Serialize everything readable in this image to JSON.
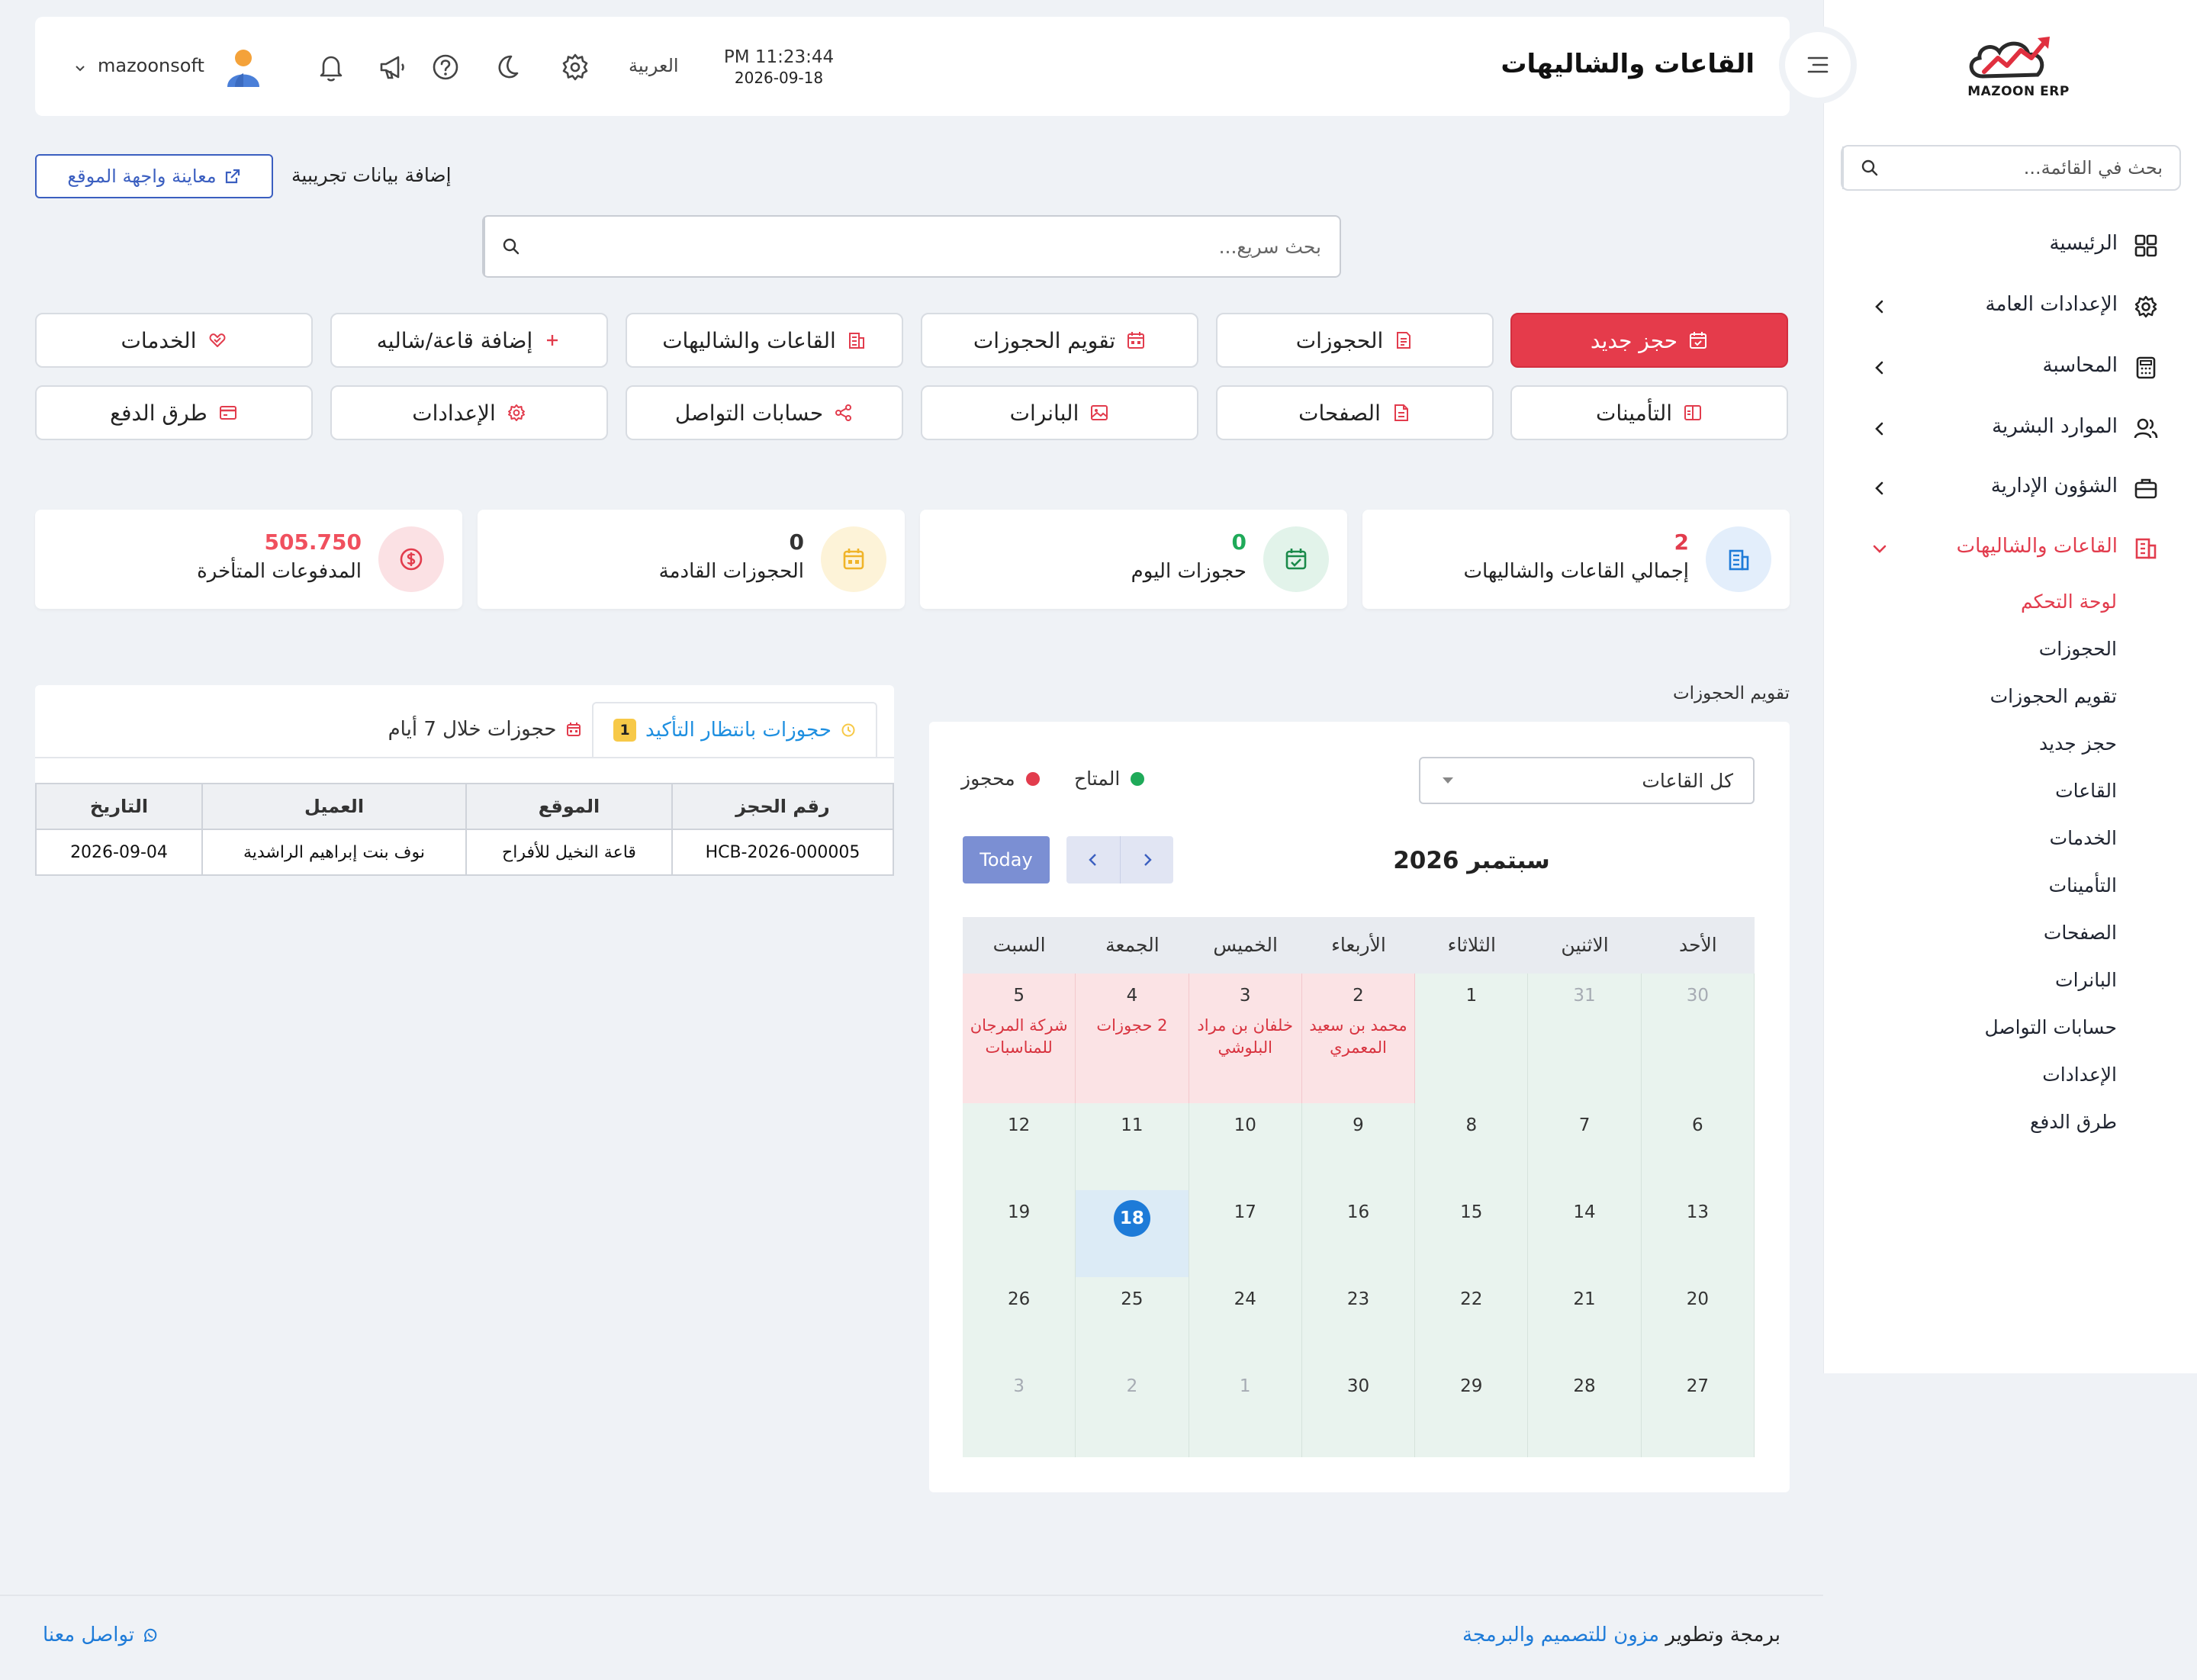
{
  "brand": {
    "logo_text": "MAZOON ERP"
  },
  "sidebar": {
    "search_placeholder": "بحث في القائمة...",
    "items": [
      {
        "label": "الرئيسية",
        "icon": "grid-icon"
      },
      {
        "label": "الإعدادات العامة",
        "icon": "gear-icon"
      },
      {
        "label": "المحاسبة",
        "icon": "calculator-icon"
      },
      {
        "label": "الموارد البشرية",
        "icon": "users-icon"
      },
      {
        "label": "الشؤون الإدارية",
        "icon": "briefcase-icon"
      },
      {
        "label": "القاعات والشاليهات",
        "icon": "building-icon"
      }
    ],
    "sub_items": [
      "لوحة التحكم",
      "الحجوزات",
      "تقويم الحجوزات",
      "حجز جديد",
      "القاعات",
      "الخدمات",
      "التأمينات",
      "الصفحات",
      "البانرات",
      "حسابات التواصل",
      "الإعدادات",
      "طرق الدفع"
    ]
  },
  "header": {
    "title": "القاعات والشاليهات",
    "time": "PM 11:23:44",
    "date": "2026-09-18",
    "language": "العربية",
    "username": "mazoonsoft"
  },
  "toolbar": {
    "preview_label": "معاينة واجهة الموقع",
    "demo_data_label": "إضافة بيانات تجريبية",
    "quick_search_placeholder": "بحث سريع..."
  },
  "actions": [
    {
      "label": "حجز جديد",
      "icon": "calendar-check-icon"
    },
    {
      "label": "الحجوزات",
      "icon": "list-doc-icon"
    },
    {
      "label": "تقويم الحجوزات",
      "icon": "calendar-icon"
    },
    {
      "label": "القاعات والشاليهات",
      "icon": "building-icon"
    },
    {
      "label": "إضافة قاعة/شاليه",
      "icon": "plus-icon"
    },
    {
      "label": "الخدمات",
      "icon": "heart-hand-icon"
    },
    {
      "label": "التأمينات",
      "icon": "shield-icon"
    },
    {
      "label": "الصفحات",
      "icon": "page-icon"
    },
    {
      "label": "البانرات",
      "icon": "image-icon"
    },
    {
      "label": "حسابات التواصل",
      "icon": "share-icon"
    },
    {
      "label": "الإعدادات",
      "icon": "gear-icon"
    },
    {
      "label": "طرق الدفع",
      "icon": "credit-card-icon"
    }
  ],
  "stats": [
    {
      "value": "2",
      "label": "إجمالي القاعات والشاليهات",
      "color": "#e23c4d",
      "icon": "building-icon"
    },
    {
      "value": "0",
      "label": "حجوزات اليوم",
      "color": "#1faa59",
      "icon": "calendar-check-icon"
    },
    {
      "value": "0",
      "label": "الحجوزات القادمة",
      "color": "#333333",
      "icon": "calendar-icon"
    },
    {
      "value": "505.750",
      "label": "المدفوعات المتأخرة",
      "color": "#f0505e",
      "icon": "dollar-icon"
    }
  ],
  "calendar": {
    "section_title": "تقويم الحجوزات",
    "hall_filter": "كل القاعات",
    "legend_available": "المتاح",
    "legend_booked": "محجوز",
    "today_label": "Today",
    "month_title": "سبتمبر 2026",
    "weekdays": [
      "الأحد",
      "الاثنين",
      "الثلاثاء",
      "الأربعاء",
      "الخميس",
      "الجمعة",
      "السبت"
    ],
    "weeks": [
      [
        {
          "d": "30",
          "muted": true,
          "state": "free"
        },
        {
          "d": "31",
          "muted": true,
          "state": "free"
        },
        {
          "d": "1",
          "state": "free"
        },
        {
          "d": "2",
          "state": "booked",
          "event": "محمد بن سعيد المعمري"
        },
        {
          "d": "3",
          "state": "booked",
          "event": "خلفان بن مراد البلوشي"
        },
        {
          "d": "4",
          "state": "booked",
          "event": "2 حجوزات"
        },
        {
          "d": "5",
          "state": "booked",
          "event": "شركة المرجان للمناسبات"
        }
      ],
      [
        {
          "d": "6",
          "state": "free"
        },
        {
          "d": "7",
          "state": "free"
        },
        {
          "d": "8",
          "state": "free"
        },
        {
          "d": "9",
          "state": "free"
        },
        {
          "d": "10",
          "state": "free"
        },
        {
          "d": "11",
          "state": "free"
        },
        {
          "d": "12",
          "state": "free"
        }
      ],
      [
        {
          "d": "13",
          "state": "free"
        },
        {
          "d": "14",
          "state": "free"
        },
        {
          "d": "15",
          "state": "free"
        },
        {
          "d": "16",
          "state": "free"
        },
        {
          "d": "17",
          "state": "free"
        },
        {
          "d": "18",
          "state": "today"
        },
        {
          "d": "19",
          "state": "free"
        }
      ],
      [
        {
          "d": "20",
          "state": "free"
        },
        {
          "d": "21",
          "state": "free"
        },
        {
          "d": "22",
          "state": "free"
        },
        {
          "d": "23",
          "state": "free"
        },
        {
          "d": "24",
          "state": "free"
        },
        {
          "d": "25",
          "state": "free"
        },
        {
          "d": "26",
          "state": "free"
        }
      ],
      [
        {
          "d": "27",
          "state": "free"
        },
        {
          "d": "28",
          "state": "free"
        },
        {
          "d": "29",
          "state": "free"
        },
        {
          "d": "30",
          "state": "free"
        },
        {
          "d": "1",
          "muted": true,
          "state": "free"
        },
        {
          "d": "2",
          "muted": true,
          "state": "free"
        },
        {
          "d": "3",
          "muted": true,
          "state": "free"
        }
      ]
    ]
  },
  "bookings": {
    "tab_pending": "حجوزات بانتظار التأكيد",
    "pending_count": "1",
    "tab_week": "حجوزات خلال 7 أيام",
    "columns": [
      "رقم الحجز",
      "الموقع",
      "العميل",
      "التاريخ"
    ],
    "rows": [
      [
        "HCB-2026-000005",
        "قاعة النخيل للأفراح",
        "نوف بنت إبراهيم الراشدية",
        "2026-09-04"
      ]
    ]
  },
  "footer": {
    "credit_prefix": "برمجة وتطوير",
    "credit_company": "مزون للتصميم والبرمجة",
    "contact": "تواصل معنا"
  }
}
